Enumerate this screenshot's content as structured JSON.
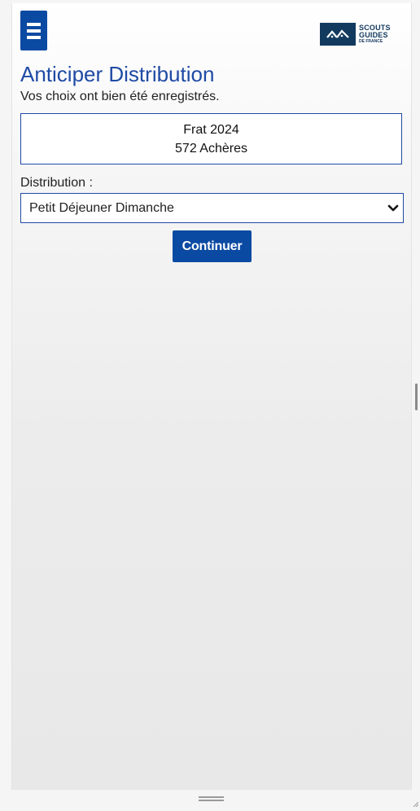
{
  "header": {
    "menu_icon": "hamburger-menu-icon",
    "logo": {
      "line1": "SCOUTS",
      "line2": "GUIDES",
      "line3": "DE FRANCE",
      "color": "#123a5e"
    }
  },
  "main": {
    "title": "Anticiper Distribution",
    "confirmation": "Vos choix ont bien été enregistrés.",
    "event": {
      "name": "Frat 2024",
      "location": "572 Achères"
    },
    "distribution": {
      "label": "Distribution :",
      "selected": "Petit Déjeuner Dimanche"
    },
    "continue_label": "Continuer"
  },
  "colors": {
    "accent": "#0b4aa2",
    "title": "#1f4aa5"
  }
}
